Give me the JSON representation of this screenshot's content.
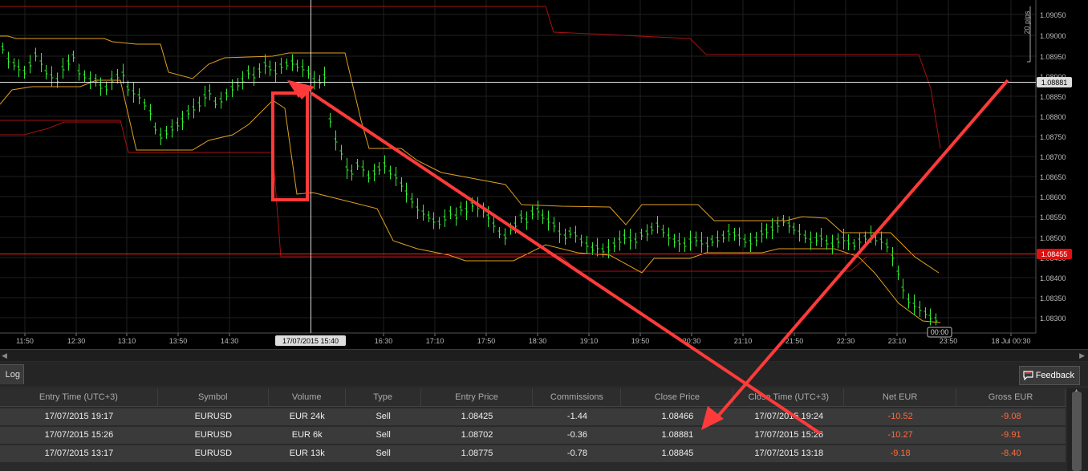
{
  "chart": {
    "price_labels": [
      "1.09050",
      "1.09000",
      "1.08950",
      "1.08900",
      "1.08850",
      "1.08800",
      "1.08750",
      "1.08700",
      "1.08650",
      "1.08600",
      "1.08550",
      "1.08500",
      "1.08450",
      "1.08400",
      "1.08350",
      "1.08300"
    ],
    "time_labels": [
      "11:50",
      "12:30",
      "13:10",
      "13:50",
      "14:30",
      "16:30",
      "17:10",
      "17:50",
      "18:30",
      "19:10",
      "19:50",
      "20:30",
      "21:10",
      "21:50",
      "22:30",
      "23:10",
      "23:50",
      "18 Jul 00:30"
    ],
    "crosshair_time": "17/07/2015 15:40",
    "crosshair_price": "1.08881",
    "current_price": "1.08455",
    "pips_scale": "20 pips",
    "cursor_time": "00:00",
    "colors": {
      "candle": "#33ee33",
      "envelope": "#e0a020",
      "outer_band": "#aa1010",
      "crosshair": "#ffffff",
      "price_line": "#ff2020",
      "annotation": "#ff3a3a"
    }
  },
  "panel": {
    "tab_label": "Log",
    "feedback_label": "Feedback",
    "columns": [
      "Entry Time (UTC+3)",
      "Symbol",
      "Volume",
      "Type",
      "Entry Price",
      "Commissions",
      "Close Price",
      "Close Time (UTC+3)",
      "Net EUR",
      "Gross EUR"
    ],
    "rows": [
      {
        "entry_time": "17/07/2015 19:17",
        "symbol": "EURUSD",
        "volume": "EUR 24k",
        "type": "Sell",
        "entry_price": "1.08425",
        "commissions": "-1.44",
        "close_price": "1.08466",
        "close_time": "17/07/2015 19:24",
        "net": "-10.52",
        "gross": "-9.08"
      },
      {
        "entry_time": "17/07/2015 15:26",
        "symbol": "EURUSD",
        "volume": "EUR 6k",
        "type": "Sell",
        "entry_price": "1.08702",
        "commissions": "-0.36",
        "close_price": "1.08881",
        "close_time": "17/07/2015 15:26",
        "net": "-10.27",
        "gross": "-9.91"
      },
      {
        "entry_time": "17/07/2015 13:17",
        "symbol": "EURUSD",
        "volume": "EUR 13k",
        "type": "Sell",
        "entry_price": "1.08775",
        "commissions": "-0.78",
        "close_price": "1.08845",
        "close_time": "17/07/2015 13:18",
        "net": "-9.18",
        "gross": "-8.40"
      }
    ]
  }
}
